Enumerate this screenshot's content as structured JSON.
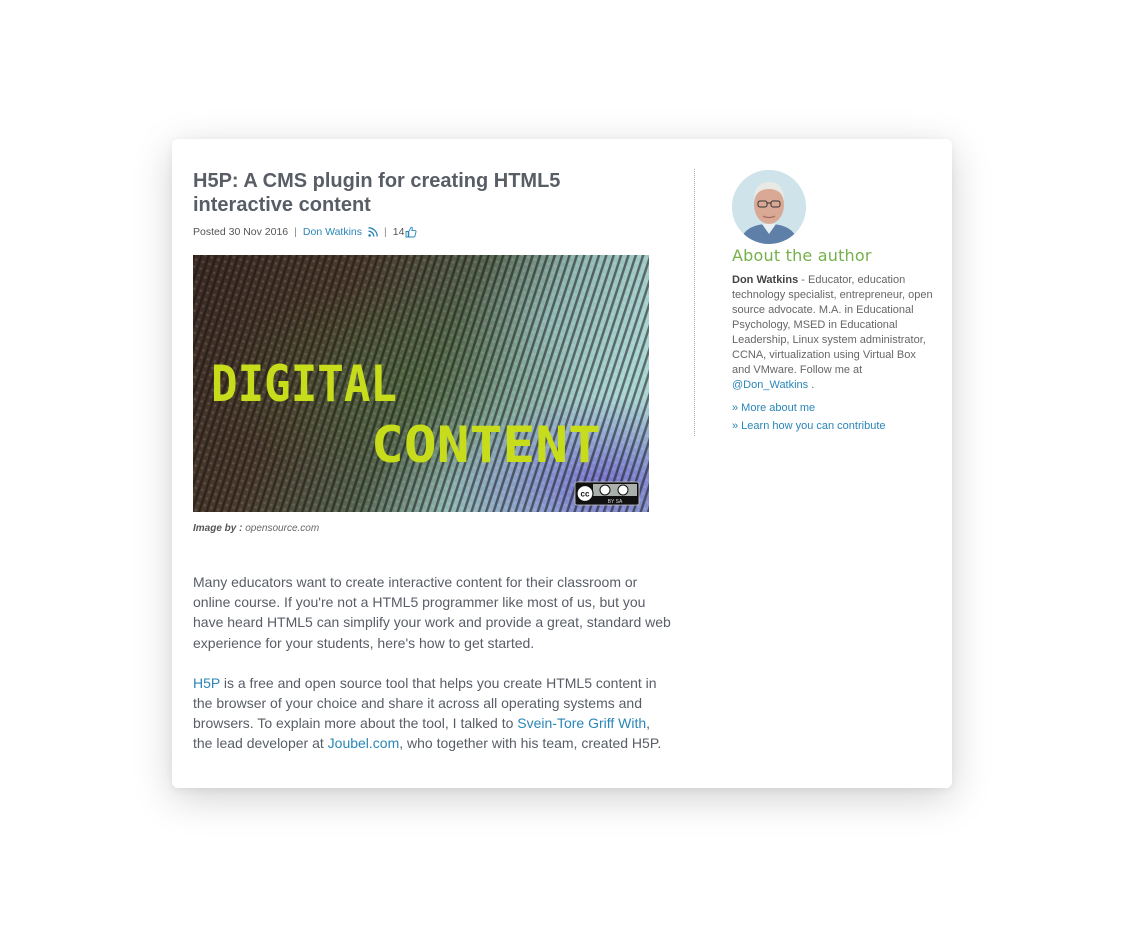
{
  "article": {
    "title": "H5P: A CMS plugin for creating HTML5 interactive content",
    "posted_label": "Posted 30 Nov 2016",
    "author_link": "Don Watkins",
    "like_count": "14",
    "image_text_line1": "DIGITAL",
    "image_text_line2": "CONTENT",
    "image_badge_label": "BY SA",
    "caption_label": "Image by :",
    "caption_source": "opensource.com",
    "paragraph1": "Many educators want to create interactive content for their classroom or online course. If you're not a HTML5 programmer like most of us, but you have heard HTML5 can simplify your work and provide a great, standard web experience for your students, here's how to get started.",
    "p2_link1": "H5P",
    "p2_text1": " is a free and open source tool that helps you create HTML5 content in the browser of your choice and share it across all operating systems and browsers. To explain more about the tool, I talked to ",
    "p2_link2": "Svein-Tore Griff With",
    "p2_text2": ", the lead developer at ",
    "p2_link3": "Joubel.com",
    "p2_text3": ", who together with his team, created H5P."
  },
  "sidebar": {
    "about_title": "About the author",
    "author_name": "Don Watkins",
    "bio_text": " - Educator, education technology specialist,  entrepreneur, open source advocate. M.A. in Educational Psychology, MSED in Educational Leadership, Linux system administrator, CCNA, virtualization using Virtual Box and VMware. Follow me at ",
    "twitter_handle": "@Don_Watkins",
    "bio_end": " .",
    "more_link": "» More about me",
    "contribute_link": "» Learn how you can contribute"
  },
  "colors": {
    "link": "#2a86b8",
    "about_title": "#75b04a",
    "text": "#585d66"
  }
}
